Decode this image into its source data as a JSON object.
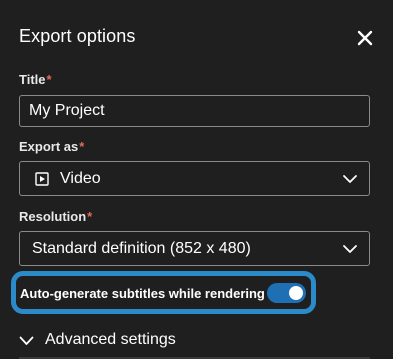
{
  "dialog": {
    "title": "Export options",
    "close_icon": "close-icon"
  },
  "fields": {
    "title": {
      "label": "Title",
      "required_mark": "*",
      "value": "My Project"
    },
    "export_as": {
      "label": "Export as",
      "required_mark": "*",
      "selected": "Video",
      "icon": "video-play-icon"
    },
    "resolution": {
      "label": "Resolution",
      "required_mark": "*",
      "selected": "Standard definition (852 x 480)"
    }
  },
  "subtitles": {
    "label": "Auto-generate subtitles while rendering",
    "enabled": true
  },
  "advanced": {
    "label": "Advanced settings"
  },
  "colors": {
    "background": "#1f1f1f",
    "required": "#e06c5b",
    "focus_ring": "#2b8bc9",
    "toggle_on": "#1e6fb3"
  }
}
